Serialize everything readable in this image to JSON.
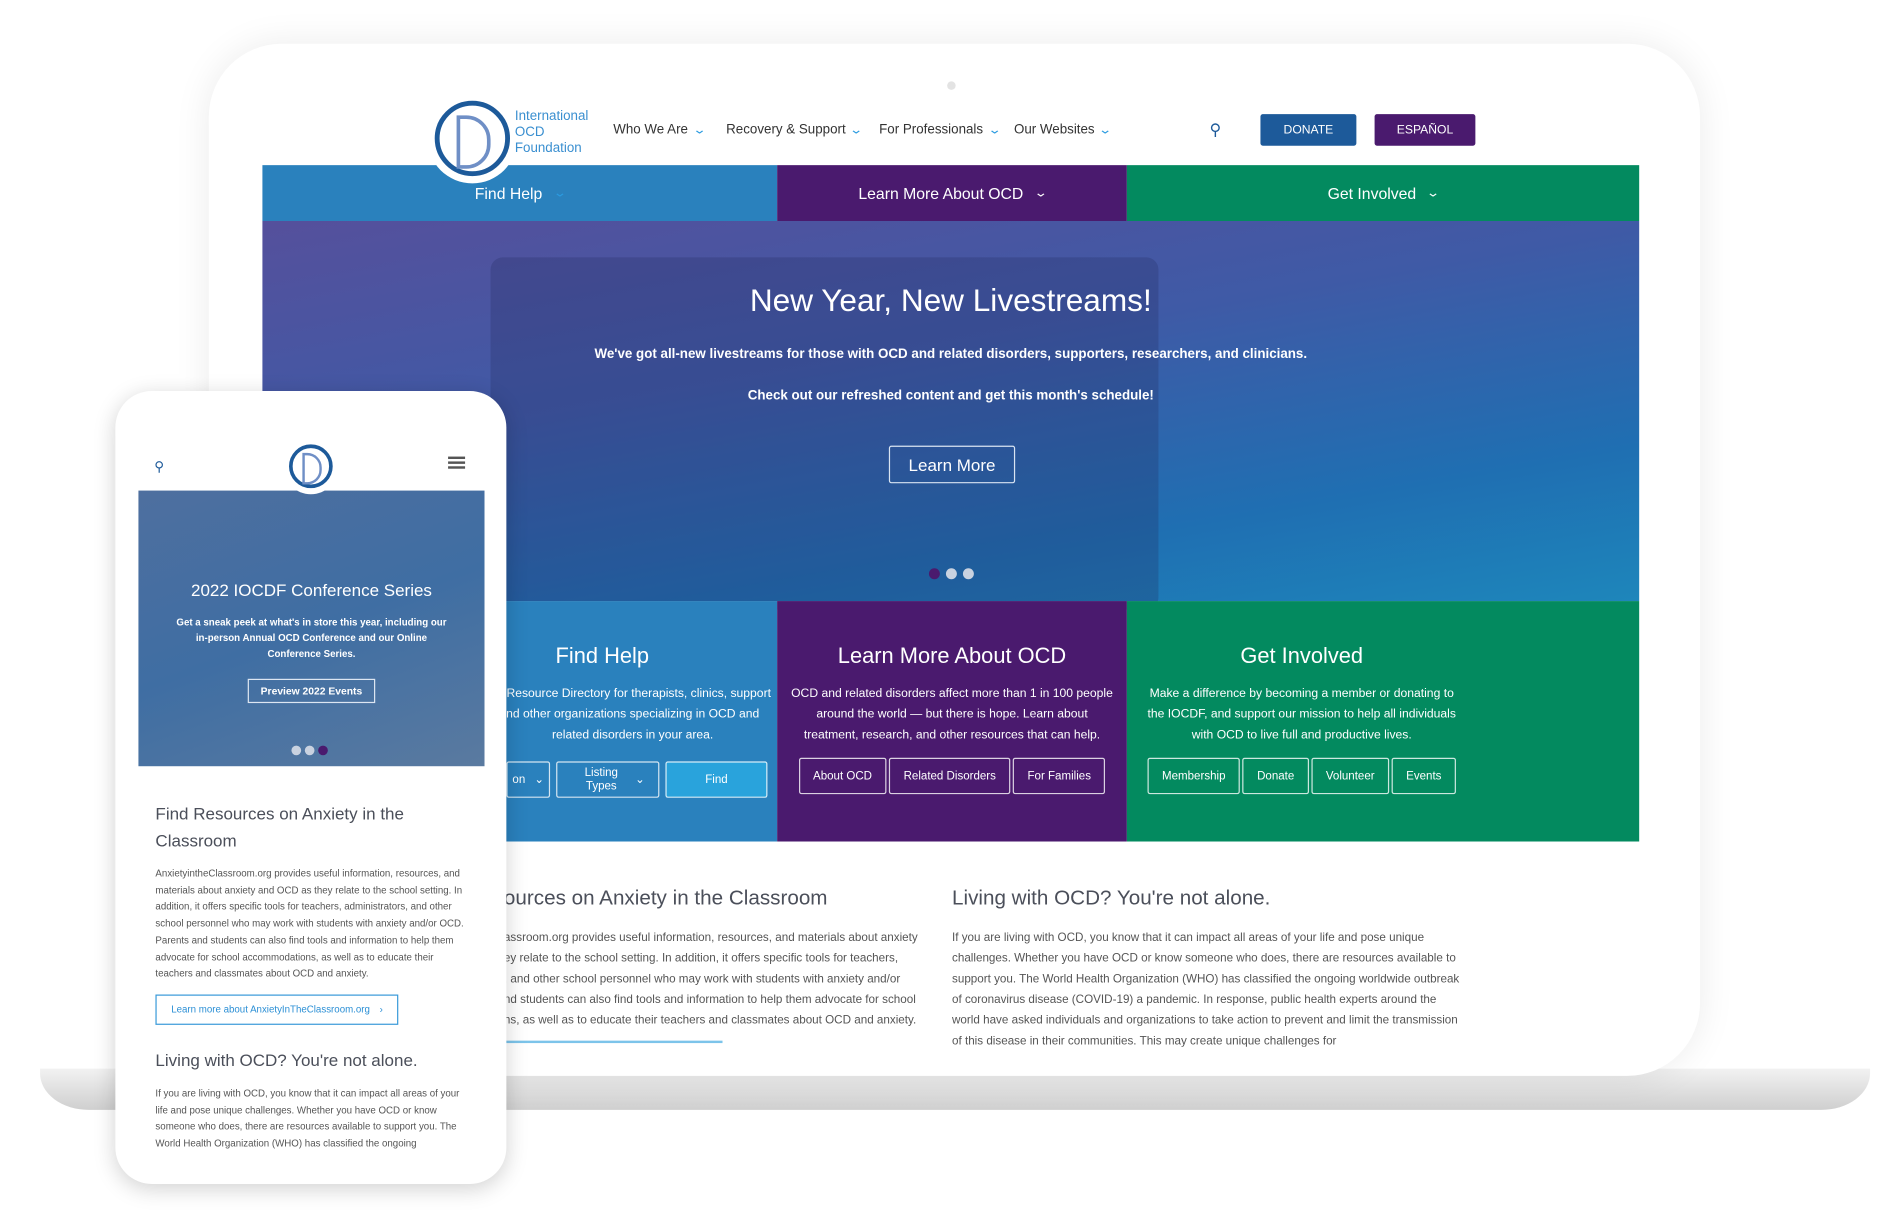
{
  "logo_text": [
    "International",
    "OCD",
    "Foundation"
  ],
  "nav": [
    {
      "label": "Who We Are"
    },
    {
      "label": "Recovery & Support"
    },
    {
      "label": "For Professionals"
    },
    {
      "label": "Our Websites"
    }
  ],
  "buttons": {
    "donate": "DONATE",
    "espanol": "ESPAÑOL"
  },
  "colors": {
    "blue": "#2a81bd",
    "purple": "#4a1a6e",
    "green": "#038a5f",
    "donate": "#1d5a9a",
    "espanol": "#4a1a6e"
  },
  "tabs": [
    {
      "label": "Find Help"
    },
    {
      "label": "Learn More About OCD"
    },
    {
      "label": "Get Involved"
    }
  ],
  "hero": {
    "title": "New Year, New Livestreams!",
    "line1": "We've got all-new livestreams for those with OCD and related disorders, supporters, researchers, and clinicians.",
    "line2": "Check out our refreshed content and get this month's schedule!",
    "cta": "Learn More",
    "slide_active": 1,
    "slide_count": 3
  },
  "cards": {
    "find_help": {
      "title": "Find Help",
      "lines": [
        "Resource Directory for therapists, clinics, support",
        "nd other organizations specializing in OCD and",
        "related disorders in your area."
      ],
      "location_partial": "on",
      "listing": "Listing Types",
      "find": "Find"
    },
    "learn": {
      "title": "Learn More About OCD",
      "text": "OCD and related disorders affect more than 1 in 100 people around the world — but there is hope. Learn about treatment, research, and other resources that can help.",
      "buttons": [
        "About OCD",
        "Related Disorders",
        "For Families"
      ]
    },
    "involved": {
      "title": "Get Involved",
      "text": "Make a difference by becoming a member or donating to the IOCDF, and support our mission to help all individuals with OCD to live full and productive lives.",
      "buttons": [
        "Membership",
        "Donate",
        "Volunteer",
        "Events"
      ]
    }
  },
  "sections": {
    "anxiety": {
      "title": "ources on Anxiety in the Classroom",
      "lines": [
        "assroom.org provides useful information, resources, and materials about anxiety",
        "ey relate to the school setting. In addition, it offers specific tools for teachers,",
        ", and other school personnel who may work with students with anxiety and/or",
        "nd students can also find tools and information to help them advocate for school",
        "ns, as well as to educate their teachers and classmates about OCD and anxiety."
      ]
    },
    "living": {
      "title": "Living with OCD? You're not alone.",
      "text": "If you are living with OCD, you know that it can impact all areas of your life and pose unique challenges. Whether you have OCD or know someone who does, there are resources available to support you. The World Health Organization (WHO) has classified the ongoing worldwide outbreak of coronavirus disease (COVID-19) a pandemic. In response, public health experts around the world have asked individuals and organizations to take action to prevent and limit the transmission of this disease in their communities. This may create unique challenges for"
    }
  },
  "phone": {
    "hero_title": "2022 IOCDF Conference Series",
    "hero_text": "Get a sneak peek at what's in store this year, including our in-person Annual OCD Conference and our Online Conference Series.",
    "hero_cta": "Preview 2022 Events",
    "slide_active": 3,
    "anxiety_title": "Find Resources on Anxiety in the Classroom",
    "anxiety_text": "AnxietyintheClassroom.org provides useful information, resources, and materials about anxiety and OCD as they relate to the school setting. In addition, it offers specific tools for teachers, administrators, and other school personnel who may work with students with anxiety and/or OCD. Parents and students can also find tools and information to help them advocate for school accommodations, as well as to educate their teachers and classmates about OCD and anxiety.",
    "anxiety_link": "Learn more about AnxietyInTheClassroom.org",
    "living_title": "Living with OCD? You're not alone.",
    "living_text": "If you are living with OCD, you know that it can impact all areas of your life and pose unique challenges. Whether you have OCD or know someone who does, there are resources available to support you. The World Health Organization (WHO) has classified the ongoing"
  }
}
